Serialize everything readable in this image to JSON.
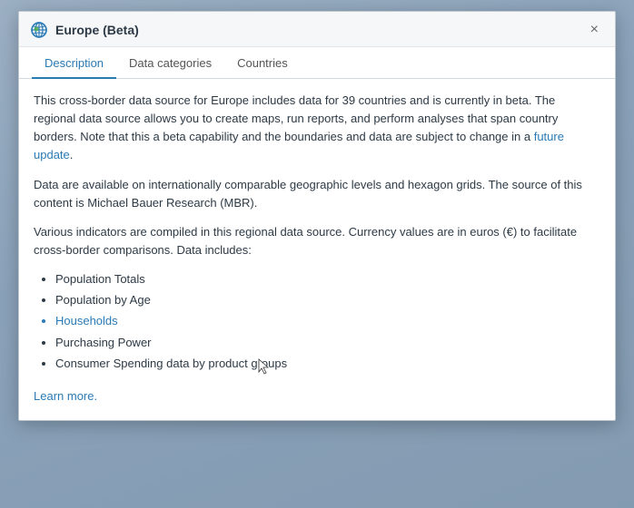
{
  "map": {
    "background": "blue-gray map"
  },
  "dialog": {
    "title": "Europe (Beta)",
    "close_label": "×",
    "tabs": [
      {
        "id": "description",
        "label": "Description",
        "active": true
      },
      {
        "id": "data-categories",
        "label": "Data categories",
        "active": false
      },
      {
        "id": "countries",
        "label": "Countries",
        "active": false
      }
    ],
    "description": {
      "para1_part1": "This cross-border data source for Europe includes data for 39 countries and is currently in beta. The regional data source allows you to create maps, run reports, and perform analyses that span country borders. Note that this a beta capability and the boundaries and data are subject to change in a ",
      "para1_link": "future update",
      "para1_end": ".",
      "para2": "Data are available on internationally comparable geographic levels and hexagon grids. The source of this content is Michael Bauer Research (MBR).",
      "para3_part1": "Various indicators are compiled in this regional data source. Currency values are in euros (€) to facilitate cross-border comparisons. Data includes:",
      "list_items": [
        {
          "text": "Population Totals",
          "blue": false
        },
        {
          "text": "Population by Age",
          "blue": false
        },
        {
          "text": "Households",
          "blue": true
        },
        {
          "text": "Purchasing Power",
          "blue": false
        },
        {
          "text": "Consumer Spending data by product groups",
          "blue": false
        }
      ],
      "learn_more": "Learn more."
    }
  }
}
